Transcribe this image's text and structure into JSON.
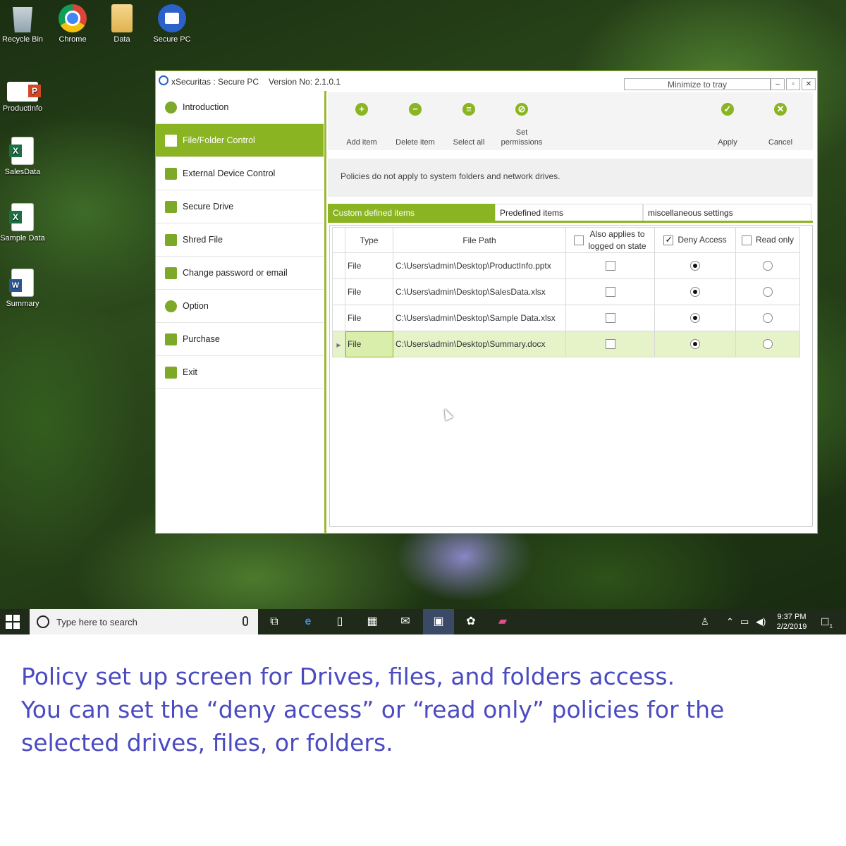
{
  "desktop": {
    "icons": [
      {
        "label": "Recycle Bin",
        "icon": "recycle-bin-icon"
      },
      {
        "label": "Chrome",
        "icon": "chrome-icon"
      },
      {
        "label": "Data",
        "icon": "folder-icon"
      },
      {
        "label": "Secure PC",
        "icon": "secure-pc-icon"
      },
      {
        "label": "ProductInfo",
        "icon": "powerpoint-file-icon"
      },
      {
        "label": "SalesData",
        "icon": "excel-file-icon"
      },
      {
        "label": "Sample Data",
        "icon": "excel-file-icon"
      },
      {
        "label": "Summary",
        "icon": "word-file-icon"
      }
    ]
  },
  "app": {
    "title": "xSecuritas : Secure PC",
    "version": "Version No: 2.1.0.1",
    "minimize_to_tray": "Minimize to tray",
    "window_buttons": {
      "minimize": "–",
      "maximize": "▫",
      "close": "✕"
    },
    "accent_color": "#8bb423",
    "nav": [
      {
        "label": "Introduction",
        "icon": "info-icon"
      },
      {
        "label": "File/Folder Control",
        "icon": "folder-icon",
        "active": true
      },
      {
        "label": "External Device Control",
        "icon": "printer-icon"
      },
      {
        "label": "Secure Drive",
        "icon": "lock-icon"
      },
      {
        "label": "Shred File",
        "icon": "shredder-icon"
      },
      {
        "label": "Change password or email",
        "icon": "key-icon"
      },
      {
        "label": "Option",
        "icon": "gear-icon"
      },
      {
        "label": "Purchase",
        "icon": "cart-icon"
      },
      {
        "label": "Exit",
        "icon": "exit-icon"
      }
    ],
    "toolbar": {
      "add": "Add item",
      "delete": "Delete item",
      "select_all": "Select all",
      "set_permissions_1": "Set",
      "set_permissions_2": "permissions",
      "apply": "Apply",
      "cancel": "Cancel"
    },
    "notice": "Policies do not apply to system folders and network drives.",
    "tabs": [
      "Custom defined items",
      "Predefined items",
      "miscellaneous settings"
    ],
    "grid": {
      "headers": {
        "type": "Type",
        "path": "File Path",
        "also_applies_1": "Also applies to",
        "also_applies_2": "logged on state",
        "deny": "Deny Access",
        "read_only": "Read only"
      },
      "header_checks": {
        "also_applies": false,
        "deny": true,
        "read_only": false
      },
      "rows": [
        {
          "type": "File",
          "path": "C:\\Users\\admin\\Desktop\\ProductInfo.pptx",
          "also_applies": false,
          "deny": true,
          "read_only": false,
          "selected": false
        },
        {
          "type": "File",
          "path": "C:\\Users\\admin\\Desktop\\SalesData.xlsx",
          "also_applies": false,
          "deny": true,
          "read_only": false,
          "selected": false
        },
        {
          "type": "File",
          "path": "C:\\Users\\admin\\Desktop\\Sample Data.xlsx",
          "also_applies": false,
          "deny": true,
          "read_only": false,
          "selected": false
        },
        {
          "type": "File",
          "path": "C:\\Users\\admin\\Desktop\\Summary.docx",
          "also_applies": false,
          "deny": true,
          "read_only": false,
          "selected": true
        }
      ]
    }
  },
  "taskbar": {
    "search_placeholder": "Type here to search",
    "apps": [
      "task-view-icon",
      "edge-icon",
      "file-icon",
      "store-icon",
      "mail-icon",
      "secure-pc-icon",
      "photos-icon",
      "paint-icon"
    ],
    "time": "9:37 PM",
    "date": "2/2/2019",
    "notification_count": "1"
  },
  "caption": {
    "line1": "Policy set up screen for Drives, files, and folders access.",
    "line2": "You can set the “deny access” or “read only” policies for the selected drives, files, or folders."
  }
}
